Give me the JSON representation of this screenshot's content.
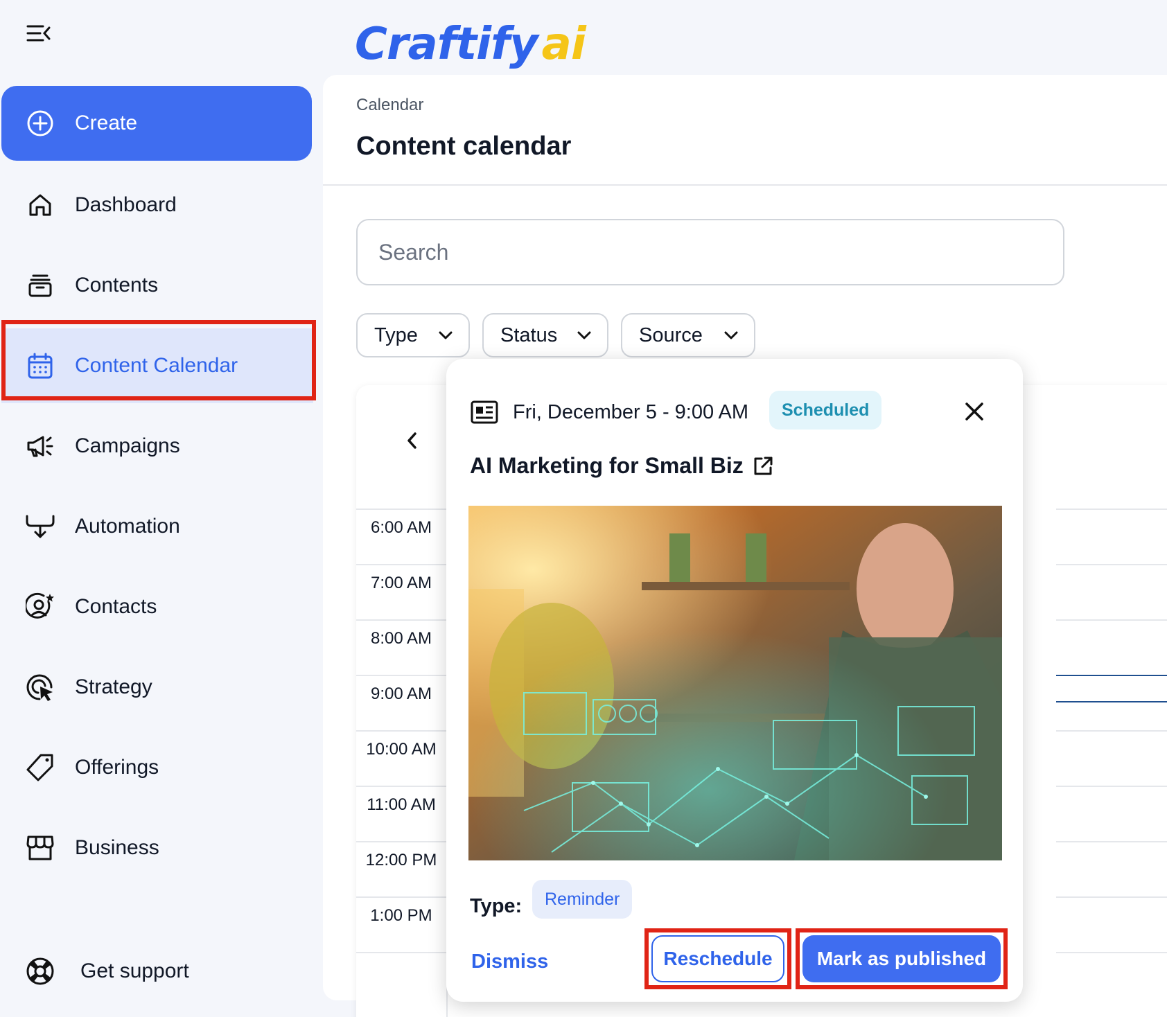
{
  "app": {
    "logo_main": "Craftify",
    "logo_accent": "ai"
  },
  "sidebar": {
    "create_label": "Create",
    "items": [
      {
        "label": "Dashboard",
        "icon": "home-icon"
      },
      {
        "label": "Contents",
        "icon": "archive-icon"
      },
      {
        "label": "Content Calendar",
        "icon": "calendar-icon",
        "active": true
      },
      {
        "label": "Campaigns",
        "icon": "megaphone-icon"
      },
      {
        "label": "Automation",
        "icon": "automation-icon"
      },
      {
        "label": "Contacts",
        "icon": "contact-star-icon"
      },
      {
        "label": "Strategy",
        "icon": "target-cursor-icon"
      },
      {
        "label": "Offerings",
        "icon": "tag-icon"
      },
      {
        "label": "Business",
        "icon": "store-icon"
      }
    ],
    "support_label": "Get support"
  },
  "header": {
    "breadcrumb": "Calendar",
    "title": "Content calendar"
  },
  "search": {
    "placeholder": "Search"
  },
  "filters": [
    "Type",
    "Status",
    "Source"
  ],
  "calendar": {
    "times": [
      "6:00 AM",
      "7:00 AM",
      "8:00 AM",
      "9:00 AM",
      "10:00 AM",
      "11:00 AM",
      "12:00 PM",
      "1:00 PM"
    ]
  },
  "popup": {
    "datetime": "Fri, December 5 - 9:00 AM",
    "status": "Scheduled",
    "title": "AI Marketing for Small Biz",
    "type_label": "Type:",
    "type_value": "Reminder",
    "dismiss_label": "Dismiss",
    "reschedule_label": "Reschedule",
    "publish_label": "Mark as published"
  },
  "colors": {
    "accent": "#3f6df0",
    "highlight": "#e02416",
    "scheduled": "#1d8fb0"
  }
}
